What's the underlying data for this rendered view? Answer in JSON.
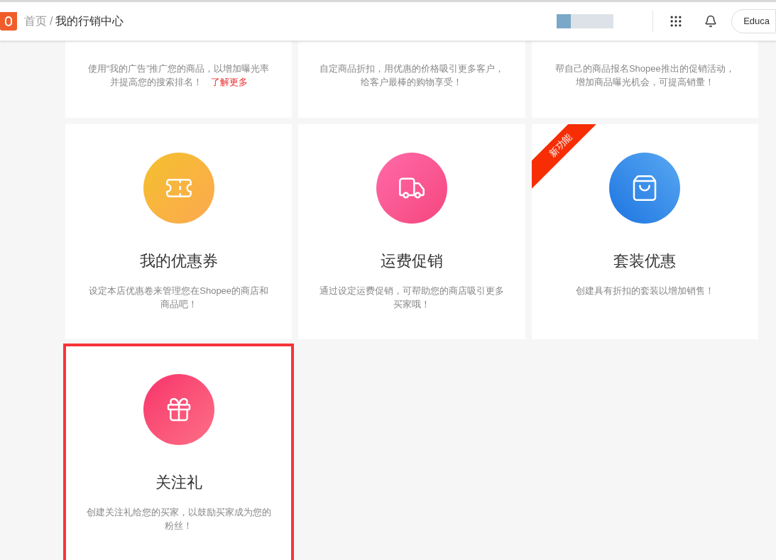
{
  "header": {
    "breadcrumb": [
      {
        "label": "首页",
        "current": false
      },
      {
        "label": "我的行销中心",
        "current": true
      }
    ],
    "separator": "/",
    "account_button": "Educa"
  },
  "top_cards": [
    {
      "description": "使用“我的广告”推广您的商品，以增加曝光率并提高您的搜索排名！",
      "link": "了解更多"
    },
    {
      "description": "自定商品折扣，用优惠的价格吸引更多客户，给客户最棒的购物享受！"
    },
    {
      "description": "帮自己的商品报名Shopee推出的促销活动，增加商品曝光机会，可提高销量！"
    }
  ],
  "cards": [
    {
      "kind": "coupon",
      "title": "我的优惠券",
      "description": "设定本店优惠卷来管理您在Shopee的商店和商品吧！",
      "selected": false
    },
    {
      "kind": "shipping",
      "title": "运费促销",
      "description": "通过设定运费促销，可帮助您的商店吸引更多买家哦！",
      "selected": false
    },
    {
      "kind": "bundle",
      "title": "套装优惠",
      "description": "创建具有折扣的套装以增加销售！",
      "badge": "新功能",
      "selected": false
    },
    {
      "kind": "gift",
      "title": "关注礼",
      "description": "创建关注礼给您的买家，以鼓励买家成为您的粉丝！",
      "selected": true
    }
  ]
}
